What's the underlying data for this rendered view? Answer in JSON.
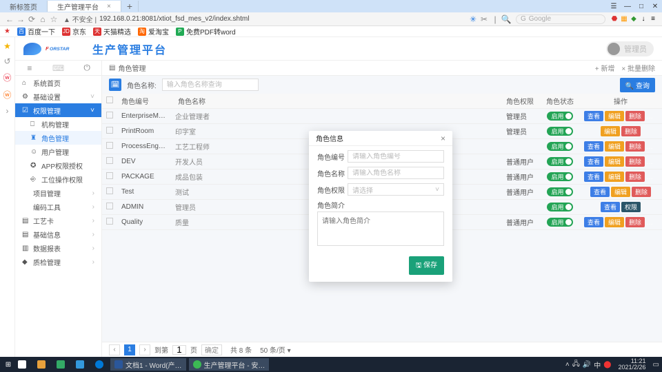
{
  "tabs": {
    "blank": "新标签页",
    "app": "生产管理平台"
  },
  "win": {
    "menu": "☰",
    "min": "—",
    "max": "□",
    "close": "✕",
    "plus": "+"
  },
  "addr": {
    "insecure": "▲ 不安全 |",
    "url": "192.168.0.21:8081/xtiot_fsd_mes_v2/index.shtml",
    "search_ph": "Google"
  },
  "bookmarks": [
    {
      "ico": "百",
      "cls": "blue",
      "label": "百度一下"
    },
    {
      "ico": "JD",
      "cls": "red",
      "label": "京东"
    },
    {
      "ico": "天",
      "cls": "red",
      "label": "天猫精选"
    },
    {
      "ico": "淘",
      "cls": "orange",
      "label": "爱淘宝"
    },
    {
      "ico": "P",
      "cls": "green",
      "label": "免费PDF转word"
    }
  ],
  "header": {
    "brand": "FORSTAR",
    "title": "生产管理平台",
    "user": "管理员"
  },
  "sidebar": {
    "groups": [
      {
        "label": "系统首页",
        "icn": "⌂"
      },
      {
        "label": "基础设置",
        "icn": "⚙",
        "chev": "˅"
      },
      {
        "label": "权限管理",
        "icn": "☑",
        "chev": "˅",
        "active": true,
        "subs": [
          {
            "label": "机构管理",
            "icn": "⎕"
          },
          {
            "label": "角色管理",
            "icn": "♜",
            "highlight": true
          },
          {
            "label": "用户管理",
            "icn": "☺"
          },
          {
            "label": "APP权限授权",
            "icn": "✪"
          },
          {
            "label": "工位操作权限",
            "icn": "⎆"
          }
        ]
      },
      {
        "label": "项目管理",
        "chev": "›"
      },
      {
        "label": "编码工具",
        "chev": "›"
      },
      {
        "label": "工艺卡",
        "icn": "▤",
        "chev": "›"
      },
      {
        "label": "基础信息",
        "icn": "▤",
        "chev": "›"
      },
      {
        "label": "数据报表",
        "icn": "▥",
        "chev": "›"
      },
      {
        "label": "质检管理",
        "icn": "◆",
        "chev": "›"
      }
    ]
  },
  "crumb": {
    "icon": "▤",
    "title": "角色管理",
    "add": "+ 新增",
    "del": "× 批量删除"
  },
  "filter": {
    "label": "角色名称:",
    "placeholder": "输入角色名称查询",
    "search": "🔍 查询"
  },
  "table": {
    "headers": {
      "code": "角色编号",
      "name": "角色名称",
      "perm": "角色权限",
      "status": "角色状态",
      "ops": "操作"
    },
    "switch_on": "启用",
    "ops": {
      "view": "查看",
      "edit": "编辑",
      "del": "删除",
      "perm": "权限"
    },
    "rows": [
      {
        "code": "EnterpriseM…",
        "name": "企业管理者",
        "perm": "管理员",
        "ops": "all"
      },
      {
        "code": "PrintRoom",
        "name": "印字室",
        "perm": "管理员",
        "ops": "noview"
      },
      {
        "code": "ProcessEng…",
        "name": "工艺工程师",
        "perm": "",
        "ops": "all"
      },
      {
        "code": "DEV",
        "name": "开发人员",
        "perm": "普通用户",
        "ops": "all"
      },
      {
        "code": "PACKAGE",
        "name": "成品包装",
        "perm": "普通用户",
        "ops": "all"
      },
      {
        "code": "Test",
        "name": "测试",
        "perm": "普通用户",
        "ops": "ved"
      },
      {
        "code": "ADMIN",
        "name": "管理员",
        "perm": "",
        "ops": "vperm"
      },
      {
        "code": "Quality",
        "name": "质量",
        "perm": "普通用户",
        "ops": "all"
      }
    ]
  },
  "pager": {
    "prev": "‹",
    "p1": "1",
    "next": "›",
    "to": "到第",
    "page": "页",
    "go": "确定",
    "total": "共 8 条",
    "size": "50 条/页 ▾"
  },
  "modal": {
    "title": "角色信息",
    "fields": {
      "code": {
        "label": "角色编号",
        "ph": "请输入角色编号"
      },
      "name": {
        "label": "角色名称",
        "ph": "请输入角色名称"
      },
      "perm": {
        "label": "角色权限",
        "ph": "请选择"
      },
      "intro": {
        "label": "角色简介",
        "ph": "请输入角色简介"
      }
    },
    "save": "🖫 保存"
  },
  "taskbar": {
    "items": [
      {
        "cls": "",
        "label": ""
      }
    ],
    "word": "文档1 - Word(产…",
    "app": "生产管理平台 - 安…",
    "ime": "中",
    "clock": "11:21",
    "date": "2021/2/26"
  }
}
